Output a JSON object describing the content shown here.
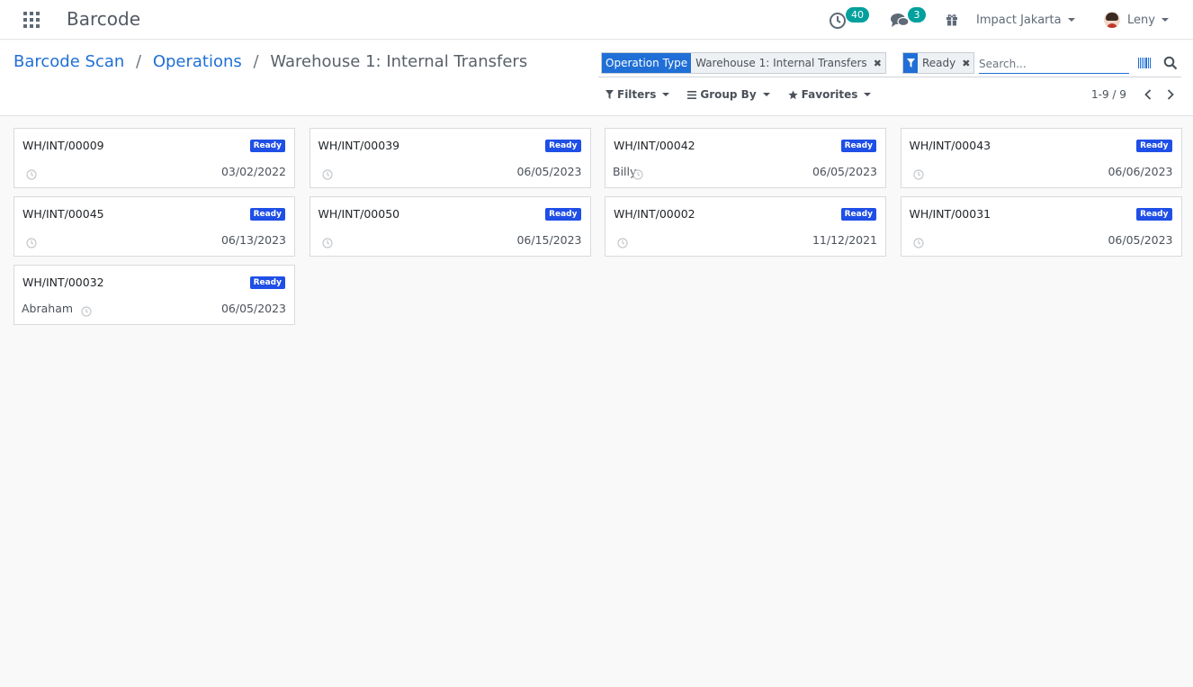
{
  "navbar": {
    "app_name": "Barcode",
    "activity_count": "40",
    "messages_count": "3",
    "company": "Impact Jakarta",
    "user": "Leny"
  },
  "breadcrumb": {
    "items": [
      "Barcode Scan",
      "Operations"
    ],
    "current": "Warehouse 1: Internal Transfers",
    "separator": "/"
  },
  "search": {
    "facets": [
      {
        "label": "Operation Type",
        "value": "Warehouse 1: Internal Transfers"
      },
      {
        "icon": "filter-icon",
        "value": "Ready"
      }
    ],
    "placeholder": "Search...",
    "options": {
      "filters": "Filters",
      "group_by": "Group By",
      "favorites": "Favorites"
    }
  },
  "pager": {
    "value": "1-9 / 9"
  },
  "colors": {
    "accent": "#1f6fd6",
    "ready_badge": "#1f4fe6",
    "counter_badge": "#00a09d"
  },
  "cards": [
    {
      "ref": "WH/INT/00009",
      "status": "Ready",
      "user": "",
      "date": "03/02/2022"
    },
    {
      "ref": "WH/INT/00039",
      "status": "Ready",
      "user": "",
      "date": "06/05/2023"
    },
    {
      "ref": "WH/INT/00042",
      "status": "Ready",
      "user": "Billy",
      "date": "06/05/2023"
    },
    {
      "ref": "WH/INT/00043",
      "status": "Ready",
      "user": "",
      "date": "06/06/2023"
    },
    {
      "ref": "WH/INT/00045",
      "status": "Ready",
      "user": "",
      "date": "06/13/2023"
    },
    {
      "ref": "WH/INT/00050",
      "status": "Ready",
      "user": "",
      "date": "06/15/2023"
    },
    {
      "ref": "WH/INT/00002",
      "status": "Ready",
      "user": "",
      "date": "11/12/2021"
    },
    {
      "ref": "WH/INT/00031",
      "status": "Ready",
      "user": "",
      "date": "06/05/2023"
    },
    {
      "ref": "WH/INT/00032",
      "status": "Ready",
      "user": "Abraham",
      "date": "06/05/2023"
    }
  ]
}
